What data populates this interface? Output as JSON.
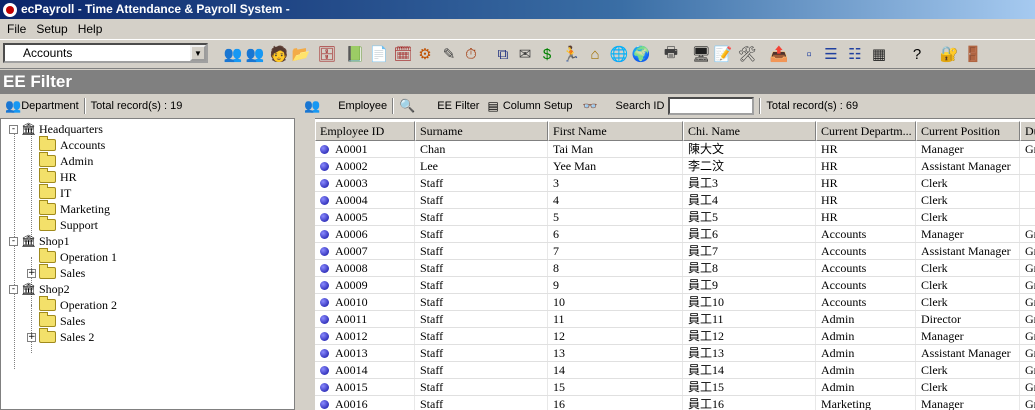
{
  "window": {
    "title": "ecPayroll - Time Attendance & Payroll System -"
  },
  "menu": [
    "File",
    "Setup",
    "Help"
  ],
  "toolbar": {
    "department_combo": "Accounts",
    "buttons": [
      {
        "name": "employees-icon",
        "glyph": "👥",
        "color": "#2a3aa8"
      },
      {
        "name": "group-icon",
        "glyph": "👥",
        "color": "#7a3aa8"
      },
      {
        "name": "person-card-icon",
        "glyph": "🧑",
        "color": "#805020"
      },
      {
        "name": "folder-open-icon",
        "glyph": "📂",
        "color": "#c8a000"
      },
      {
        "name": "cabinet-icon",
        "glyph": "🗄",
        "color": "#a02020"
      },
      {
        "name": "book-icon",
        "glyph": "📗",
        "color": "#205030"
      },
      {
        "name": "document-icon",
        "glyph": "📄",
        "color": "#404040"
      },
      {
        "name": "report-icon",
        "glyph": "🗓",
        "color": "#a02020"
      },
      {
        "name": "gear-icon",
        "glyph": "⚙",
        "color": "#c05000"
      },
      {
        "name": "edit-icon",
        "glyph": "✎",
        "color": "#404040"
      },
      {
        "name": "clock-icon",
        "glyph": "⏱",
        "color": "#a03000"
      },
      {
        "name": "copy-icon",
        "glyph": "⧉",
        "color": "#203080"
      },
      {
        "name": "mail-icon",
        "glyph": "✉",
        "color": "#404040"
      },
      {
        "name": "dollar-icon",
        "glyph": "$",
        "color": "#008000"
      },
      {
        "name": "runner-icon",
        "glyph": "🏃",
        "color": "#208020"
      },
      {
        "name": "home-icon",
        "glyph": "⌂",
        "color": "#a07000"
      },
      {
        "name": "globe-pin-icon",
        "glyph": "🌐",
        "color": "#006060"
      },
      {
        "name": "globe-icon",
        "glyph": "🌍",
        "color": "#0040a0"
      },
      {
        "name": "printer-icon",
        "glyph": "🖶",
        "color": "#404040"
      },
      {
        "name": "monitor-icon",
        "glyph": "🖥",
        "color": "#202020"
      },
      {
        "name": "edit-doc-icon",
        "glyph": "📝",
        "color": "#404040"
      },
      {
        "name": "tools-icon",
        "glyph": "🛠",
        "color": "#404040"
      },
      {
        "name": "export-icon",
        "glyph": "📤",
        "color": "#404040"
      },
      {
        "name": "small-icons-icon",
        "glyph": "▫",
        "color": "#2040a0"
      },
      {
        "name": "list-icon",
        "glyph": "☰",
        "color": "#2040a0"
      },
      {
        "name": "details-icon",
        "glyph": "☷",
        "color": "#2040a0"
      },
      {
        "name": "grid-view-icon",
        "glyph": "▦",
        "color": "#202020"
      },
      {
        "name": "help-icon",
        "glyph": "?",
        "color": "#000000"
      },
      {
        "name": "user-key-icon",
        "glyph": "🔐",
        "color": "#202020"
      },
      {
        "name": "exit-icon",
        "glyph": "🚪",
        "color": "#206020"
      }
    ]
  },
  "filter_header": "EE Filter",
  "subbar": {
    "department_label": "Department",
    "left_total": "Total record(s) : 19",
    "employee_label": "Employee",
    "ee_filter_label": "EE Filter",
    "column_setup_label": "Column Setup",
    "search_label": "Search ID",
    "search_value": "",
    "right_total": "Total record(s) : 69"
  },
  "tree": [
    {
      "label": "Headquarters",
      "level": 0,
      "type": "building",
      "expander": "-"
    },
    {
      "label": "Accounts",
      "level": 1,
      "type": "folder"
    },
    {
      "label": "Admin",
      "level": 1,
      "type": "folder"
    },
    {
      "label": "HR",
      "level": 1,
      "type": "folder"
    },
    {
      "label": "IT",
      "level": 1,
      "type": "folder"
    },
    {
      "label": "Marketing",
      "level": 1,
      "type": "folder"
    },
    {
      "label": "Support",
      "level": 1,
      "type": "folder"
    },
    {
      "label": "Shop1",
      "level": 0,
      "type": "building",
      "expander": "-"
    },
    {
      "label": "Operation 1",
      "level": 1,
      "type": "folder"
    },
    {
      "label": "Sales",
      "level": 1,
      "type": "folder",
      "expander": "+"
    },
    {
      "label": "Shop2",
      "level": 0,
      "type": "building",
      "expander": "-"
    },
    {
      "label": "Operation 2",
      "level": 1,
      "type": "folder"
    },
    {
      "label": "Sales",
      "level": 1,
      "type": "folder"
    },
    {
      "label": "Sales 2",
      "level": 1,
      "type": "folder",
      "expander": "+"
    }
  ],
  "grid": {
    "columns": [
      "Employee ID",
      "Surname",
      "First Name",
      "Chi. Name",
      "Current Departm...",
      "Current Position",
      "Du"
    ],
    "rows": [
      [
        "A0001",
        "Chan",
        "Tai Man",
        "陳大文",
        "HR",
        "Manager",
        "Gr"
      ],
      [
        "A0002",
        "Lee",
        "Yee Man",
        "李二汶",
        "HR",
        "Assistant Manager",
        ""
      ],
      [
        "A0003",
        "Staff",
        "3",
        "員工3",
        "HR",
        "Clerk",
        ""
      ],
      [
        "A0004",
        "Staff",
        "4",
        "員工4",
        "HR",
        "Clerk",
        ""
      ],
      [
        "A0005",
        "Staff",
        "5",
        "員工5",
        "HR",
        "Clerk",
        ""
      ],
      [
        "A0006",
        "Staff",
        "6",
        "員工6",
        "Accounts",
        "Manager",
        "Gr"
      ],
      [
        "A0007",
        "Staff",
        "7",
        "員工7",
        "Accounts",
        "Assistant Manager",
        "Gr"
      ],
      [
        "A0008",
        "Staff",
        "8",
        "員工8",
        "Accounts",
        "Clerk",
        "Gr"
      ],
      [
        "A0009",
        "Staff",
        "9",
        "員工9",
        "Accounts",
        "Clerk",
        "Gr"
      ],
      [
        "A0010",
        "Staff",
        "10",
        "員工10",
        "Accounts",
        "Clerk",
        "Gr"
      ],
      [
        "A0011",
        "Staff",
        "11",
        "員工11",
        "Admin",
        "Director",
        "Gr"
      ],
      [
        "A0012",
        "Staff",
        "12",
        "員工12",
        "Admin",
        "Manager",
        "Gr"
      ],
      [
        "A0013",
        "Staff",
        "13",
        "員工13",
        "Admin",
        "Assistant Manager",
        "Gr"
      ],
      [
        "A0014",
        "Staff",
        "14",
        "員工14",
        "Admin",
        "Clerk",
        "Gr"
      ],
      [
        "A0015",
        "Staff",
        "15",
        "員工15",
        "Admin",
        "Clerk",
        "Gr"
      ],
      [
        "A0016",
        "Staff",
        "16",
        "員工16",
        "Marketing",
        "Manager",
        "Gr"
      ]
    ]
  }
}
